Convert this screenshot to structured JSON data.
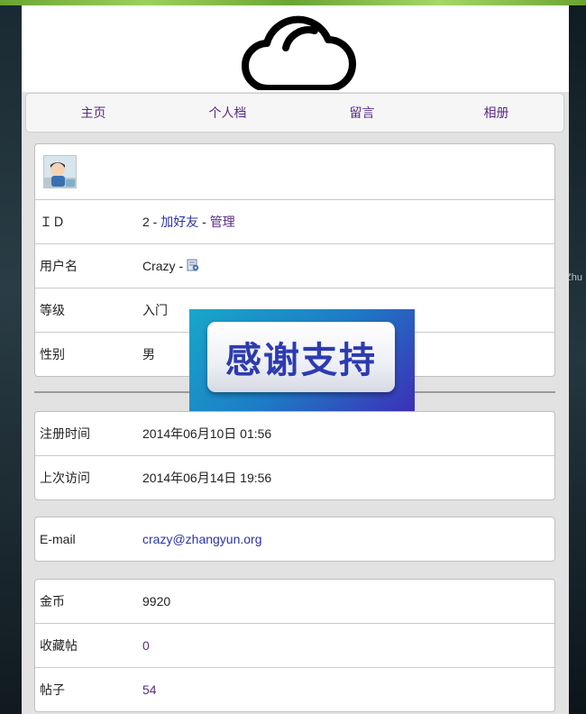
{
  "nav": {
    "items": [
      "主页",
      "个人档",
      "留言",
      "相册"
    ]
  },
  "profile": {
    "id_label": "ＩＤ",
    "id_value": "2",
    "id_sep1": " - ",
    "add_friend": "加好友",
    "id_sep2": " - ",
    "manage": "管理",
    "username_label": "用户名",
    "username_value": "Crazy",
    "username_sep": " - ",
    "level_label": "等级",
    "level_value": "入门",
    "gender_label": "性别",
    "gender_value": "男"
  },
  "times": {
    "register_label": "注册时间",
    "register_value": "2014年06月10日 01:56",
    "last_visit_label": "上次访问",
    "last_visit_value": "2014年06月14日 19:56"
  },
  "contact": {
    "email_label": "E-mail",
    "email_value": "crazy@zhangyun.org"
  },
  "stats": {
    "coins_label": "金币",
    "coins_value": "9920",
    "favorites_label": "收藏帖",
    "favorites_value": "0",
    "posts_label": "帖子",
    "posts_value": "54"
  },
  "ad": {
    "text": "感谢支持"
  },
  "background": {
    "side_text": "Zhu"
  },
  "icons": {
    "logo": "cloud-icon",
    "avatar": "user-avatar-image",
    "send": "send-message-icon"
  }
}
